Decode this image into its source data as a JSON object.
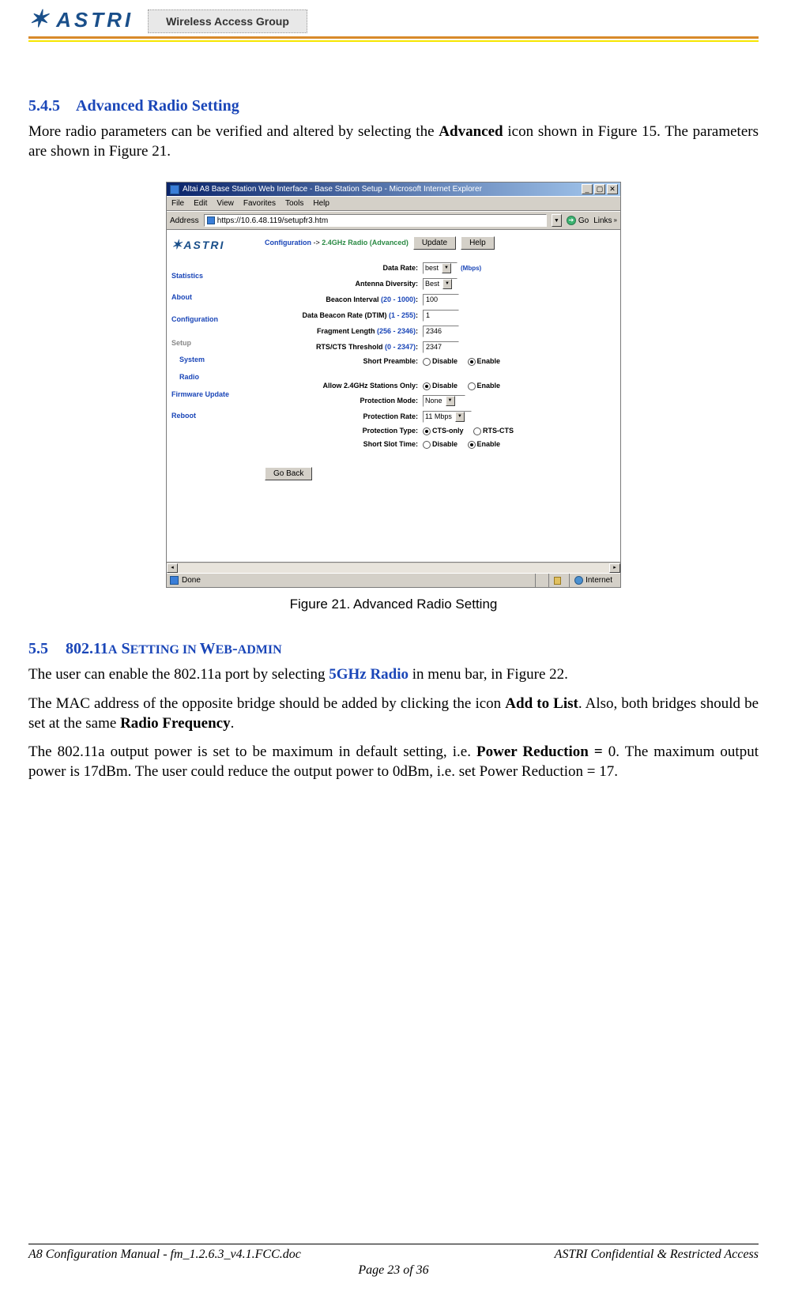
{
  "header": {
    "logo_text": "ASTRI",
    "wag_text": "Wireless Access Group"
  },
  "section_545": {
    "number": "5.4.5",
    "title": "Advanced Radio Setting",
    "para_prefix": "More radio parameters can be verified and altered by selecting the ",
    "para_bold1": "Advanced",
    "para_suffix": " icon shown in Figure 15. The parameters are shown in Figure 21."
  },
  "ie": {
    "title": "Altai A8 Base Station Web Interface - Base Station Setup - Microsoft Internet Explorer",
    "menu": {
      "file": "File",
      "edit": "Edit",
      "view": "View",
      "fav": "Favorites",
      "tools": "Tools",
      "help": "Help"
    },
    "address_label": "Address",
    "url": "https://10.6.48.119/setupfr3.htm",
    "go": "Go",
    "links": "Links",
    "sidebar": {
      "statistics": "Statistics",
      "about": "About",
      "configuration": "Configuration",
      "setup": "Setup",
      "system": "System",
      "radio": "Radio",
      "firmware": "Firmware Update",
      "reboot": "Reboot"
    },
    "crumb_label": "Configuration",
    "crumb_arrow": "->",
    "crumb_page": "2.4GHz Radio (Advanced)",
    "update_btn": "Update",
    "help_btn": "Help",
    "form": {
      "data_rate": {
        "label": "Data Rate:",
        "value": "best",
        "unit": "(Mbps)"
      },
      "antenna_div": {
        "label": "Antenna Diversity:",
        "value": "Best"
      },
      "beacon_int": {
        "label": "Beacon Interval",
        "hint": "(20 - 1000)",
        "colon": ":",
        "value": "100"
      },
      "dtim": {
        "label": "Data Beacon Rate (DTIM)",
        "hint": "(1 - 255)",
        "colon": ":",
        "value": "1"
      },
      "frag": {
        "label": "Fragment Length",
        "hint": "(256 - 2346)",
        "colon": ":",
        "value": "2346"
      },
      "rtscts": {
        "label": "RTS/CTS Threshold",
        "hint": "(0 - 2347)",
        "colon": ":",
        "value": "2347"
      },
      "short_preamble": {
        "label": "Short Preamble:",
        "disable": "Disable",
        "enable": "Enable",
        "checked": "enable"
      },
      "allow_24": {
        "label": "Allow 2.4GHz Stations Only:",
        "disable": "Disable",
        "enable": "Enable",
        "checked": "disable"
      },
      "prot_mode": {
        "label": "Protection Mode:",
        "value": "None"
      },
      "prot_rate": {
        "label": "Protection Rate:",
        "value": "11 Mbps"
      },
      "prot_type": {
        "label": "Protection Type:",
        "cts": "CTS-only",
        "rtscts": "RTS-CTS",
        "checked": "cts"
      },
      "short_slot": {
        "label": "Short Slot Time:",
        "disable": "Disable",
        "enable": "Enable",
        "checked": "enable"
      }
    },
    "go_back": "Go Back",
    "status_done": "Done",
    "status_internet": "Internet"
  },
  "figure21_caption": "Figure 21. Advanced Radio Setting",
  "section_55": {
    "number": "5.5",
    "title_a": "802.11",
    "title_asc": "A",
    "title_b": " S",
    "title_bsc": "ETTING IN ",
    "title_c": "W",
    "title_csc": "EB",
    "title_d": "-",
    "title_dsc": "ADMIN",
    "para1_a": "The user can enable the 802.11a port by selecting ",
    "para1_link": "5GHz Radio",
    "para1_b": " in menu bar, in Figure 22.",
    "para2_a": "The MAC address of the opposite bridge should be added by clicking the icon ",
    "para2_b1": "Add to List",
    "para2_c": ". Also, both bridges should be set at the same ",
    "para2_b2": "Radio Frequency",
    "para2_d": ".",
    "para3_a": "The 802.11a output power is set to be maximum in default setting, i.e. ",
    "para3_b1": "Power Reduction =",
    "para3_b1v": " 0. The maximum output power is 17dBm. The user could reduce the output power to 0dBm, i.e. set Power Reduction = 17."
  },
  "footer": {
    "left": "A8 Configuration Manual - fm_1.2.6.3_v4.1.FCC.doc",
    "right": "ASTRI Confidential & Restricted Access",
    "center": "Page 23 of 36"
  }
}
